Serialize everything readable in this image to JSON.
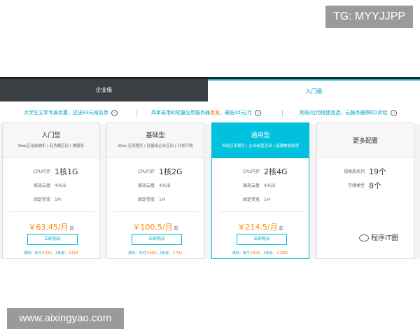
{
  "overlay": {
    "tg": "TG: MYYJJPP",
    "site": "www.aixingyao.com"
  },
  "tabs": [
    {
      "label": "企业级",
      "active": false
    },
    {
      "label": "入门级",
      "active": true
    }
  ],
  "promos": [
    {
      "text": "大学生立享专属优惠，还送83元域名券",
      "icon": "−"
    },
    {
      "pre": "简单易用的轻量应用服务器",
      "hl": "首发",
      "post": "，最低45元/月",
      "icon": "−"
    },
    {
      "text": "网站/应用搭建首选，云服务器限时2折起",
      "icon": "−"
    }
  ],
  "plans": [
    {
      "name": "入门型",
      "desc": "Web应用前端机 | 轻负载应用 | 微服务",
      "cpu_label": "CPU内存",
      "cpu_val": "1核1G",
      "disk_label": "高效云盘",
      "disk_val": "40GB",
      "bw_label": "固定带宽",
      "bw_val": "1M",
      "price": "￥63.45/月",
      "price_unit": "起",
      "buy": "立即购买",
      "foot_pre": "限时：年付",
      "foot_y": "￥335",
      "foot_mid": "，3年省：",
      "foot_s": "￥654"
    },
    {
      "name": "基础型",
      "desc": "Web 应用程序 | 轻量级企业应用 | 开发环境",
      "cpu_label": "CPU内存",
      "cpu_val": "1核2G",
      "disk_label": "高效云盘",
      "disk_val": "40GB",
      "bw_label": "固定带宽",
      "bw_val": "1M",
      "price": "￥100.5/月",
      "price_unit": "起",
      "buy": "立即购买",
      "foot_pre": "限时：年付",
      "foot_y": "￥660",
      "foot_mid": "，3年省：",
      "foot_s": "￥792"
    },
    {
      "name": "通用型",
      "desc": "网站应用程序 | 企业级营活动 | 普通数据处理",
      "cpu_label": "CPU内存",
      "cpu_val": "2核4G",
      "disk_label": "高效云盘",
      "disk_val": "40GB",
      "bw_label": "固定带宽",
      "bw_val": "1M",
      "price": "￥214.5/月",
      "price_unit": "起",
      "buy": "立即购买",
      "foot_pre": "限时：年付",
      "foot_y": "￥825",
      "foot_mid": "，3年省：",
      "foot_s": "￥2067"
    }
  ],
  "more": {
    "title": "更多配置",
    "spec_label": "规格族系列",
    "spec_val": "19个",
    "type_label": "存储类型",
    "type_val": "8个",
    "watermark": "程序IT圈"
  },
  "colors": {
    "accent": "#00b5d6",
    "price": "#ff8a00",
    "highlight": "#ff6a00",
    "dark_tab": "#3a3f44"
  }
}
